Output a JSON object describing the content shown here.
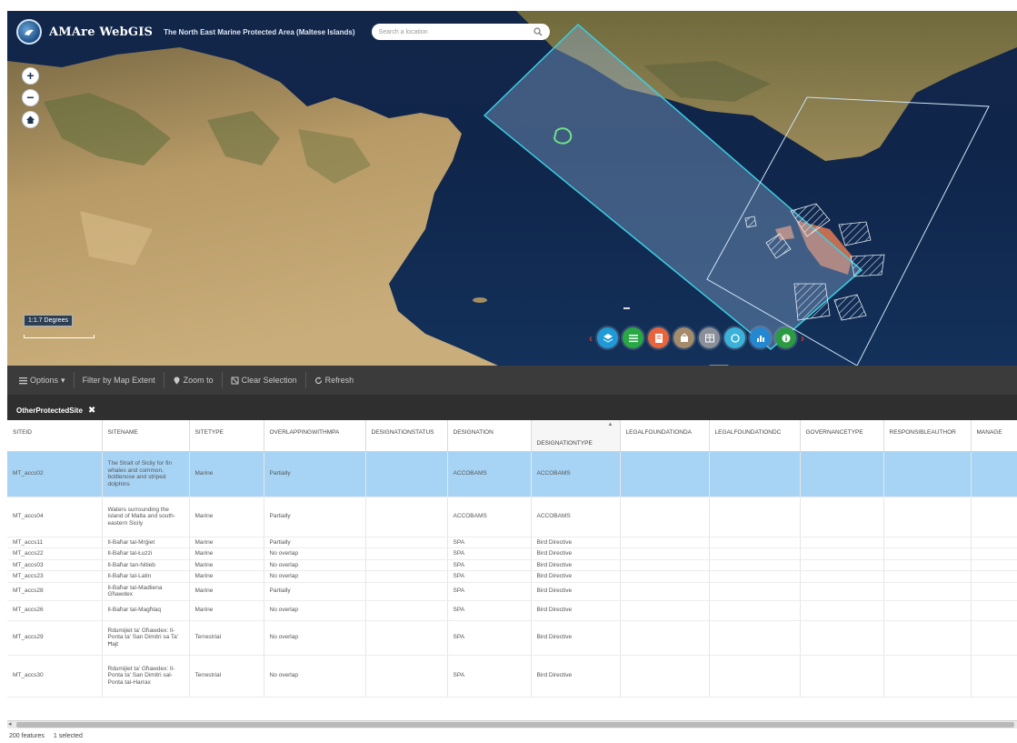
{
  "header": {
    "app_title": "AMAre WebGIS",
    "subtitle": "The North East Marine Protected Area (Maltese Islands)",
    "search_placeholder": "Search a location"
  },
  "map": {
    "zoom_in": "+",
    "zoom_out": "−",
    "scale_label": "1:1.7 Degrees",
    "tool_icons": [
      "layers-icon",
      "list-icon",
      "legend-icon",
      "basemap-icon",
      "table-icon",
      "measure-icon",
      "chart-icon",
      "info-icon"
    ],
    "tool_colors": [
      "#1f9ad6",
      "#28a745",
      "#e8643c",
      "#a38b6b",
      "#8a8f99",
      "#3ab1d9",
      "#2487cf",
      "#2b9a42"
    ]
  },
  "toolbar": {
    "options": "Options",
    "filter": "Filter by Map Extent",
    "zoom_to": "Zoom to",
    "clear": "Clear Selection",
    "refresh": "Refresh"
  },
  "layer_tab": {
    "label": "OtherProtectedSite"
  },
  "table": {
    "columns": [
      "SITEID",
      "SITENAME",
      "SITETYPE",
      "OVERLAPPINGWITHMPA",
      "DESIGNATIONSTATUS",
      "DESIGNATION",
      "DESIGNATIONTYPE",
      "LEGALFOUNDATIONDA",
      "LEGALFOUNDATIONDC",
      "GOVERNANCETYPE",
      "RESPONSIBLEAUTHOR",
      "MANAGE"
    ],
    "rows": [
      [
        "MT_accs02",
        "The Strait of Sicily for fin whales and common, bottlenose and striped dolphins",
        "Marine",
        "Partially",
        "",
        "ACCOBAMS",
        "ACCOBAMS",
        "",
        "",
        "",
        "",
        ""
      ],
      [
        "MT_accs04",
        "Waters surrounding the island of Malta and south-eastern Sicily",
        "Marine",
        "Partially",
        "",
        "ACCOBAMS",
        "ACCOBAMS",
        "",
        "",
        "",
        "",
        ""
      ],
      [
        "MT_accs11",
        "Il-Baħar tal-Mrġiet",
        "Marine",
        "Partially",
        "",
        "SPA",
        "Bird Directive",
        "",
        "",
        "",
        "",
        ""
      ],
      [
        "MT_accs22",
        "Il-Baħar tal-Łużżi",
        "Marine",
        "No overlap",
        "",
        "SPA",
        "Bird Directive",
        "",
        "",
        "",
        "",
        ""
      ],
      [
        "MT_accs03",
        "Il-Baħar tan-Nitieb",
        "Marine",
        "No overlap",
        "",
        "SPA",
        "Bird Directive",
        "",
        "",
        "",
        "",
        ""
      ],
      [
        "MT_accs23",
        "Il-Baħar tal-Latin",
        "Marine",
        "No overlap",
        "",
        "SPA",
        "Bird Directive",
        "",
        "",
        "",
        "",
        ""
      ],
      [
        "MT_accs28",
        "Il-Baħar tal-Madliena Għawdex",
        "Marine",
        "Partially",
        "",
        "SPA",
        "Bird Directive",
        "",
        "",
        "",
        "",
        ""
      ],
      [
        "MT_accs26",
        "Il-Baħar tal-Magħlaq",
        "Marine",
        "No overlap",
        "",
        "SPA",
        "Bird Directive",
        "",
        "",
        "",
        "",
        ""
      ],
      [
        "MT_accs29",
        "Rdumijiet ta' Għawdex: Il-Ponta ta' San Dimitri sa Ta' Ħajt",
        "Terrestrial",
        "No overlap",
        "",
        "SPA",
        "Bird Directive",
        "",
        "",
        "",
        "",
        ""
      ],
      [
        "MT_accs30",
        "Rdumijiet ta' Għawdex: Il-Ponta ta' San Dimitri sal-Ponta tal-Harrax",
        "Terrestrial",
        "No overlap",
        "",
        "SPA",
        "Bird Directive",
        "",
        "",
        "",
        "",
        ""
      ]
    ]
  },
  "status": {
    "features": "200 features",
    "selected": "1 selected"
  }
}
